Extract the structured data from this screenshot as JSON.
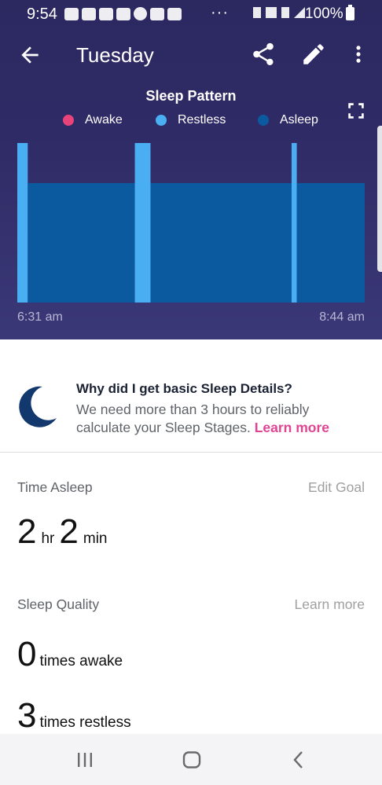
{
  "status_bar": {
    "time": "9:54",
    "ellipsis": "···",
    "battery_text": "100%",
    "notification_icons": [
      "youtube-icon",
      "news-icon",
      "fitbit-icon",
      "fitbit-icon",
      "pinterest-icon",
      "youtube-icon",
      "youtube-icon"
    ],
    "system_icons": [
      "bluetooth-icon",
      "volte-icon",
      "lte-icon",
      "signal-icon",
      "battery-icon"
    ]
  },
  "app_bar": {
    "title": "Tuesday",
    "back_icon": "arrow-left-icon",
    "share_icon": "share-icon",
    "edit_icon": "pencil-icon",
    "more_icon": "more-vert-icon"
  },
  "chart_data": {
    "type": "area",
    "title": "Sleep Pattern",
    "legend": [
      {
        "label": "Awake",
        "color": "#e8437a"
      },
      {
        "label": "Restless",
        "color": "#4aaef2"
      },
      {
        "label": "Asleep",
        "color": "#0b5aa0"
      }
    ],
    "x_start_label": "6:31 am",
    "x_end_label": "8:44 am",
    "duration_minutes": 133,
    "segments": [
      {
        "state": "Restless",
        "start_min": 0,
        "end_min": 4
      },
      {
        "state": "Asleep",
        "start_min": 4,
        "end_min": 45
      },
      {
        "state": "Restless",
        "start_min": 45,
        "end_min": 51
      },
      {
        "state": "Asleep",
        "start_min": 51,
        "end_min": 105
      },
      {
        "state": "Restless",
        "start_min": 105,
        "end_min": 107
      },
      {
        "state": "Asleep",
        "start_min": 107,
        "end_min": 133
      }
    ],
    "levels": {
      "Awake": 3,
      "Restless": 2,
      "Asleep": 1
    },
    "grid": false,
    "legend_position": "top"
  },
  "info_card": {
    "title": "Why did I get basic Sleep Details?",
    "body": "We need more than 3 hours to reliably calculate your Sleep Stages.",
    "link": "Learn more",
    "icon": "moon-icon"
  },
  "time_asleep": {
    "label": "Time Asleep",
    "action": "Edit Goal",
    "hours": "2",
    "hours_unit": "hr",
    "minutes": "2",
    "minutes_unit": "min"
  },
  "sleep_quality": {
    "label": "Sleep Quality",
    "action": "Learn more",
    "awake_count": "0",
    "awake_label": "times awake",
    "restless_count": "3",
    "restless_label": "times restless"
  },
  "nav_bar": {
    "recents_icon": "recents-icon",
    "home_icon": "home-icon",
    "back_icon": "back-icon"
  }
}
